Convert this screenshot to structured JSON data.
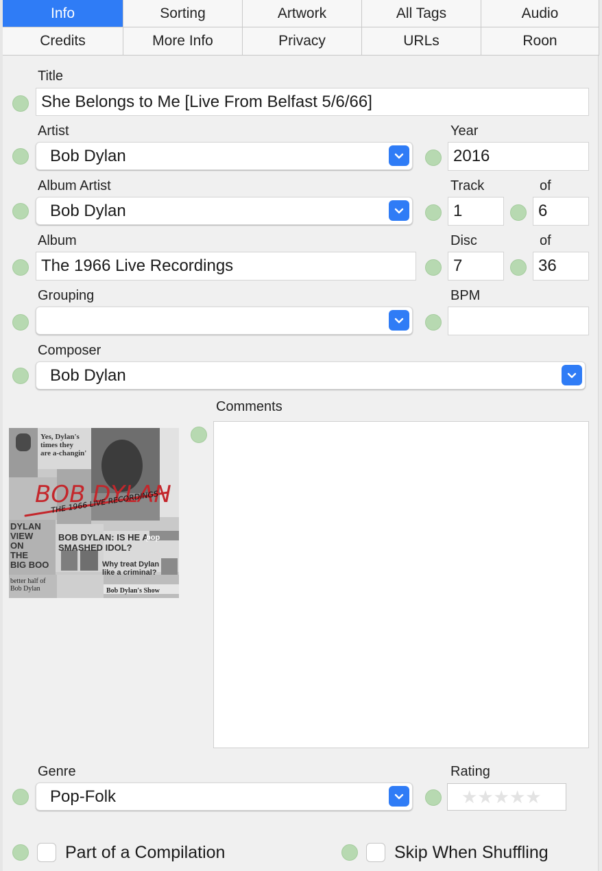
{
  "tabs": {
    "row1": [
      "Info",
      "Sorting",
      "Artwork",
      "All Tags",
      "Audio"
    ],
    "row2": [
      "Credits",
      "More Info",
      "Privacy",
      "URLs",
      "Roon"
    ],
    "selected": "Info"
  },
  "fields": {
    "title": {
      "label": "Title",
      "value": "She Belongs to Me [Live From Belfast 5/6/66]"
    },
    "artist": {
      "label": "Artist",
      "value": "Bob Dylan"
    },
    "year": {
      "label": "Year",
      "value": "2016"
    },
    "album_artist": {
      "label": "Album Artist",
      "value": "Bob Dylan"
    },
    "track": {
      "label": "Track",
      "value": "1",
      "of_label": "of",
      "of_value": "6"
    },
    "album": {
      "label": "Album",
      "value": "The 1966 Live Recordings"
    },
    "disc": {
      "label": "Disc",
      "value": "7",
      "of_label": "of",
      "of_value": "36"
    },
    "grouping": {
      "label": "Grouping",
      "value": ""
    },
    "bpm": {
      "label": "BPM",
      "value": ""
    },
    "composer": {
      "label": "Composer",
      "value": "Bob Dylan"
    },
    "comments": {
      "label": "Comments",
      "value": ""
    },
    "genre": {
      "label": "Genre",
      "value": "Pop-Folk"
    },
    "rating": {
      "label": "Rating",
      "stars_total": 5,
      "stars_filled": 0
    }
  },
  "artwork": {
    "alt": "Album artwork",
    "texts": {
      "headline1": "Yes, Dylan's times they are a-changin'",
      "logo": "BOB DYLAN",
      "subtitle": "THE 1966 LIVE RECORDINGS",
      "headline2": "BOB DYLAN: IS HE A SMASHED IDOL?",
      "left_text": "DYLAN VIEW ON THE BIG BOO",
      "bottom_left": "better half of Bob Dylan",
      "right_headline": "Why treat Dylan like a criminal?",
      "footer": "Bob Dylan's Show",
      "badge": "pop"
    }
  },
  "checkboxes": {
    "compilation": {
      "label": "Part of a Compilation",
      "checked": false
    },
    "skip_shuffle": {
      "label": "Skip When Shuffling",
      "checked": false
    }
  },
  "colors": {
    "accent": "#2f7cf6",
    "status_dot": "#b7d9b1",
    "art_red": "#c4262b"
  },
  "icons": {
    "combo": "chevron-down-icon",
    "status": "status-dot-icon",
    "rating": "star-icon"
  }
}
